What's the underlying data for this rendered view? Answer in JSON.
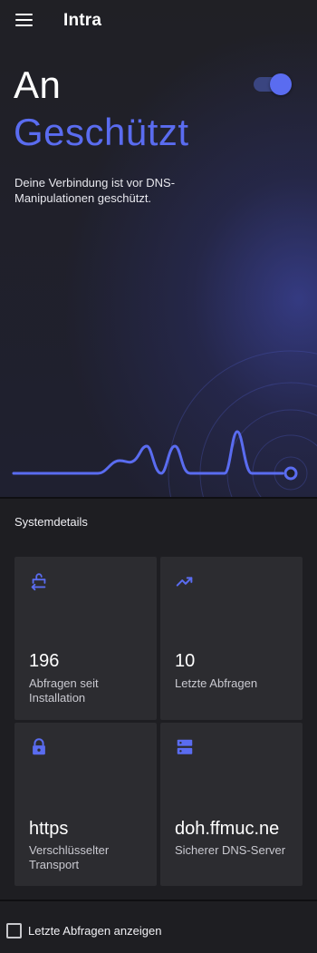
{
  "app": {
    "title": "Intra"
  },
  "status": {
    "state": "An",
    "headline": "Geschützt",
    "description": "Deine Verbindung ist vor DNS-Manipulationen geschützt.",
    "toggle_on": true
  },
  "colors": {
    "accent": "#5a6cf0",
    "background": "#1e1e22",
    "card": "#2c2c30"
  },
  "system_details": {
    "title": "Systemdetails",
    "cards": [
      {
        "icon": "lock-open-arrow-icon",
        "value": "196",
        "label": "Abfragen seit Installation"
      },
      {
        "icon": "trending-up-icon",
        "value": "10",
        "label": "Letzte Abfragen"
      },
      {
        "icon": "lock-icon",
        "value": "https",
        "label": "Verschlüsselter Transport"
      },
      {
        "icon": "dns-server-icon",
        "value": "doh.ffmuc.ne",
        "label": "Sicherer DNS-Server"
      }
    ]
  },
  "footer": {
    "checkbox_label": "Letzte Abfragen anzeigen",
    "checked": false
  }
}
